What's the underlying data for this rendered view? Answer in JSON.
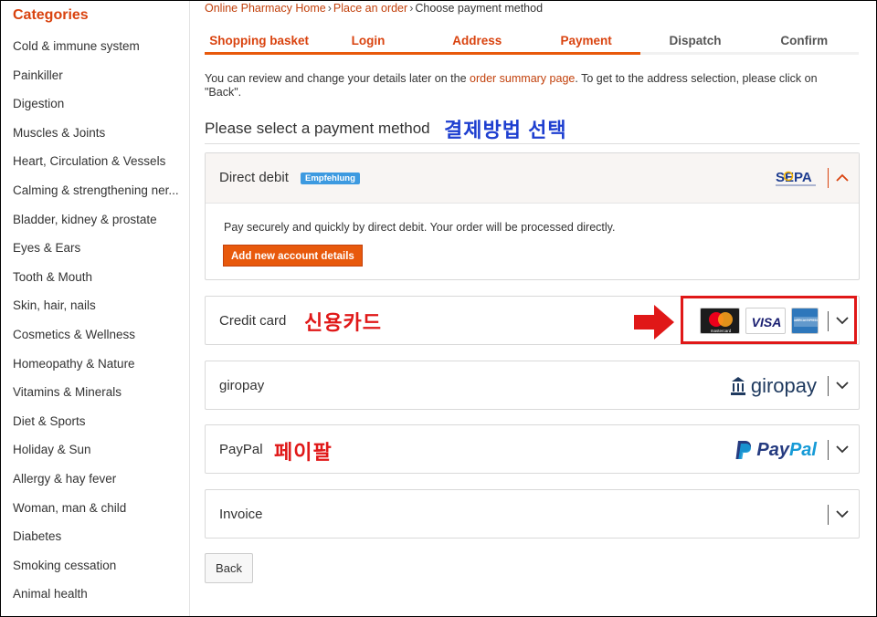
{
  "sidebar": {
    "title": "Categories",
    "items": [
      "Cold & immune system",
      "Painkiller",
      "Digestion",
      "Muscles & Joints",
      "Heart, Circulation & Vessels",
      "Calming & strengthening ner...",
      "Bladder, kidney & prostate",
      "Eyes & Ears",
      "Tooth & Mouth",
      "Skin, hair, nails",
      "Cosmetics & Wellness",
      "Homeopathy & Nature",
      "Vitamins & Minerals",
      "Diet & Sports",
      "Holiday & Sun",
      "Allergy & hay fever",
      "Woman, man & child",
      "Diabetes",
      "Smoking cessation",
      "Animal health"
    ]
  },
  "breadcrumb": {
    "home": "Online Pharmacy Home",
    "order": "Place an order",
    "current": "Choose payment method",
    "separator": "›"
  },
  "steps": [
    {
      "label": "Shopping basket",
      "state": "done"
    },
    {
      "label": "Login",
      "state": "done"
    },
    {
      "label": "Address",
      "state": "done"
    },
    {
      "label": "Payment",
      "state": "done"
    },
    {
      "label": "Dispatch",
      "state": "todo"
    },
    {
      "label": "Confirm",
      "state": "todo"
    }
  ],
  "info": {
    "before": "You can review and change your details later on the ",
    "link": "order summary page",
    "after": ". To get to the address selection, please click on \"Back\"."
  },
  "heading": "Please select a payment method",
  "annotations": {
    "heading_korean": "결제방법 선택",
    "credit_card_korean": "신용카드",
    "paypal_korean": "페이팔"
  },
  "payment_methods": {
    "direct_debit": {
      "label": "Direct debit",
      "badge": "Empfehlung",
      "logo": "SEPA",
      "description": "Pay securely and quickly by direct debit. Your order will be processed directly.",
      "button": "Add new account details",
      "expanded": true
    },
    "credit_card": {
      "label": "Credit card",
      "card_names": {
        "mastercard": "mastercard",
        "visa": "VISA",
        "amex": "AMERICAN EXPRESS"
      }
    },
    "giropay": {
      "label": "giropay",
      "logo": "giropay"
    },
    "paypal": {
      "label": "PayPal",
      "logo_pay": "Pay",
      "logo_pal": "Pal"
    },
    "invoice": {
      "label": "Invoice"
    }
  },
  "back_button": "Back",
  "colors": {
    "accent": "#e8590c",
    "link": "#c2410c",
    "badge": "#3d9ae0",
    "annotation_red": "#e01818",
    "annotation_blue": "#1e3fd0"
  }
}
